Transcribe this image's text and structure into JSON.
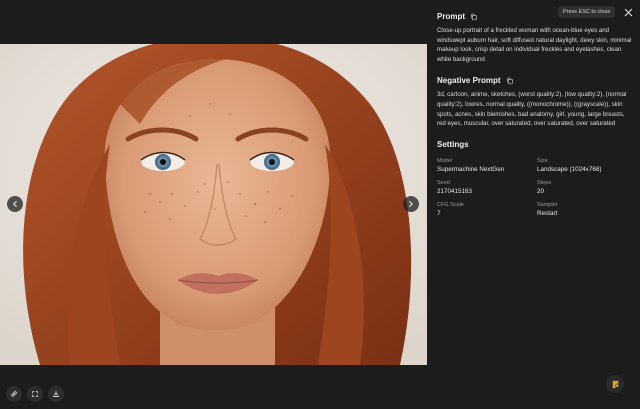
{
  "window": {
    "esc_hint": "Press ESC to close",
    "close_icon": "close-icon"
  },
  "viewer": {
    "image_alt": "Portrait of a freckled woman with blue eyes and auburn hair",
    "prev_icon": "chevron-left-icon",
    "next_icon": "chevron-right-icon",
    "toolbar": [
      {
        "name": "link-icon"
      },
      {
        "name": "fullscreen-icon"
      },
      {
        "name": "download-icon"
      }
    ]
  },
  "prompt": {
    "title": "Prompt",
    "text": "Close-up portrait of a freckled woman with ocean-blue eyes and windswept auburn hair, soft diffused natural daylight, dewy skin, minimal makeup look, crisp detail on individual freckles and eyelashes, clean white background"
  },
  "negative_prompt": {
    "title": "Negative Prompt",
    "text": "3d, cartoon, anime, sketches, (worst quality:2), (low quality:2), (normal quality:2), lowres, normal quality, ((monochrome)), ((grayscale)), skin spots, acnes, skin blemishes, bad anatomy, girl, young, large breasts, red eyes, muscular, over saturated, over saturated, over saturated"
  },
  "settings": {
    "title": "Settings",
    "model_label": "Model",
    "model_value": "Supermachine NextGen",
    "size_label": "Size",
    "size_value": "Landscape (1024x768)",
    "seed_label": "Seed",
    "seed_value": "2170415163",
    "steps_label": "Steps",
    "steps_value": "20",
    "cfg_label": "CFG Scale",
    "cfg_value": "7",
    "sampler_label": "Sampler",
    "sampler_value": "Restart"
  },
  "colors": {
    "background": "#1c1c1c",
    "brand_accent": "#f2a51c"
  }
}
